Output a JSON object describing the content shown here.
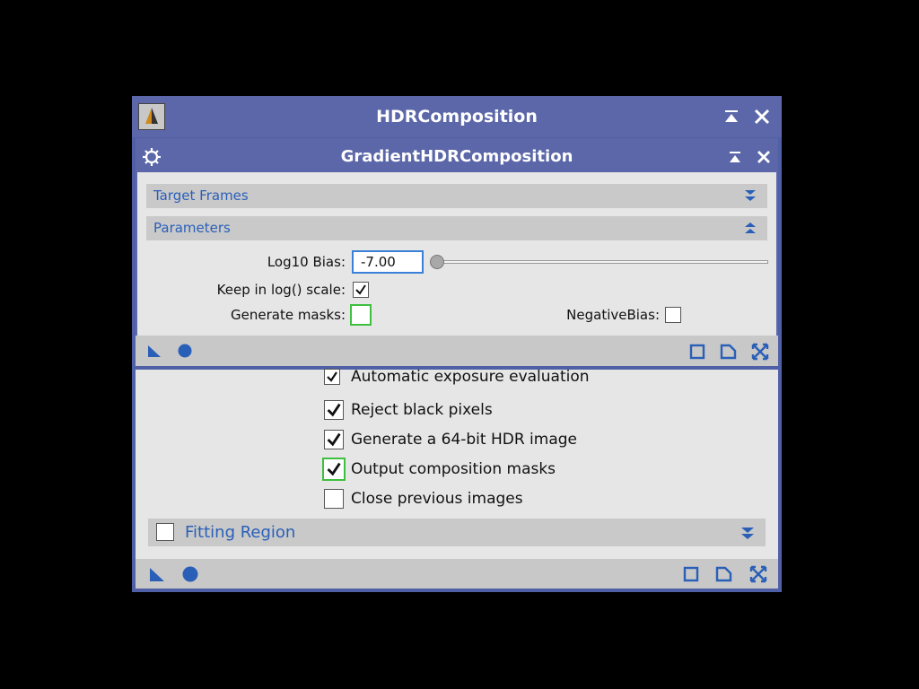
{
  "hdr_window": {
    "title": "HDRComposition",
    "options": [
      {
        "label": "Automatic exposure evaluation",
        "checked": true
      },
      {
        "label": "Reject black pixels",
        "checked": true
      },
      {
        "label": "Generate a 64-bit HDR image",
        "checked": true
      },
      {
        "label": "Output composition masks",
        "checked": true
      },
      {
        "label": "Close previous images",
        "checked": false
      }
    ],
    "fitting_region": {
      "label": "Fitting Region",
      "checked": false
    }
  },
  "grad_window": {
    "title": "GradientHDRComposition",
    "sections": {
      "target_frames": "Target Frames",
      "parameters": "Parameters"
    },
    "log10_bias": {
      "label": "Log10 Bias:",
      "value": "-7.00",
      "slider_fraction": 0.0
    },
    "keep_in_log_scale": {
      "label": "Keep in log() scale:",
      "checked": true
    },
    "generate_masks": {
      "label": "Generate masks:",
      "checked": false
    },
    "negative_bias": {
      "label": "NegativeBias:",
      "checked": false
    }
  },
  "colors": {
    "titlebar": "#5b67a8",
    "accent_blue": "#2a5fb8",
    "focus_green": "#3fbf3f"
  }
}
